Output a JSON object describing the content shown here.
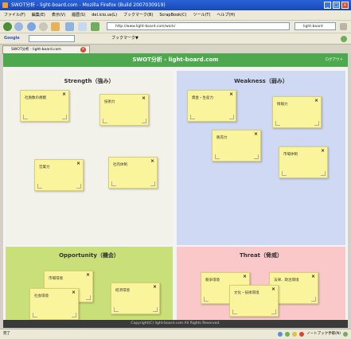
{
  "window": {
    "title": "SWOT分析 - light-board.com - Mozilla Firefox (Build 2007030919)"
  },
  "menu": [
    "ファイル(F)",
    "編集(E)",
    "表示(V)",
    "履歴(S)",
    "del.icio.us(L)",
    "ブックマーク(B)",
    "ScrapBook(C)",
    "ツール(T)",
    "ヘルプ(H)"
  ],
  "nav": {
    "address": "http://www.light-board.com/work/",
    "search_placeholder": "light-board"
  },
  "google": {
    "label": "Google",
    "bookmarks": "ブックマーク▼"
  },
  "tab": {
    "label": "SWOT分析 - light-board.com"
  },
  "app": {
    "title": "SWOT分析 - light-board.com",
    "logout": "ログアウト",
    "footer": "Copyright(C) light-board.com All Rights Reserved."
  },
  "quadrants": {
    "strength": {
      "title": "Strength（強み）",
      "notes": [
        {
          "text": "社員数の規模"
        },
        {
          "text": "技術力"
        },
        {
          "text": "営業力"
        },
        {
          "text": "社内体制"
        }
      ]
    },
    "weakness": {
      "title": "Weakness（弱み）",
      "notes": [
        {
          "text": "資金・生産力"
        },
        {
          "text": "情報力"
        },
        {
          "text": "販売力"
        },
        {
          "text": "市場体制"
        }
      ]
    },
    "opportunity": {
      "title": "Opportunity（機会）",
      "notes": [
        {
          "text": "市場環境"
        },
        {
          "text": "経済環境"
        },
        {
          "text": "社会環境"
        }
      ]
    },
    "threat": {
      "title": "Threat（脅威）",
      "notes": [
        {
          "text": "競争環境"
        },
        {
          "text": "法律、政治環境"
        },
        {
          "text": "文化・技術環境"
        }
      ]
    }
  },
  "status": {
    "left": "完了",
    "right": "ノートブック手帳(N)"
  },
  "colors": {
    "header": "#4ea84e",
    "strength": "#f2f1ea",
    "weakness": "#cfd9f4",
    "opportunity": "#c9e07a",
    "threat": "#fac8c8",
    "note": "#faf59c"
  }
}
